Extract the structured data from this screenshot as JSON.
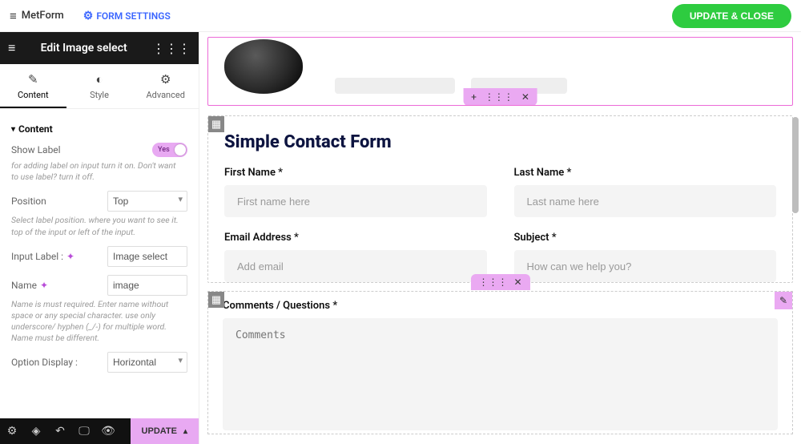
{
  "topbar": {
    "brand": "MetForm",
    "form_settings": "FORM SETTINGS",
    "update_close": "UPDATE & CLOSE"
  },
  "panel": {
    "title": "Edit Image select",
    "tabs": {
      "content": "Content",
      "style": "Style",
      "advanced": "Advanced"
    },
    "section": "Content",
    "show_label": "Show Label",
    "show_label_value": "Yes",
    "show_label_help": "for adding label on input turn it on. Don't want to use label? turn it off.",
    "position_label": "Position",
    "position_value": "Top",
    "position_help": "Select label position. where you want to see it. top of the input or left of the input.",
    "input_label": "Input Label :",
    "input_label_value": "Image select",
    "name_label": "Name",
    "name_value": "image",
    "name_help": "Name is must required. Enter name without space or any special character. use only underscore/ hyphen (_/-) for multiple word. Name must be different.",
    "option_display_label": "Option Display :",
    "option_display_value": "Horizontal"
  },
  "footer": {
    "update": "UPDATE"
  },
  "form": {
    "title": "Simple Contact Form",
    "first_name_label": "First Name *",
    "first_name_placeholder": "First name here",
    "last_name_label": "Last Name *",
    "last_name_placeholder": "Last name here",
    "email_label": "Email Address *",
    "email_placeholder": "Add email",
    "subject_label": "Subject *",
    "subject_placeholder": "How can we help you?",
    "comments_label": "Comments / Questions *",
    "comments_placeholder": "Comments"
  }
}
